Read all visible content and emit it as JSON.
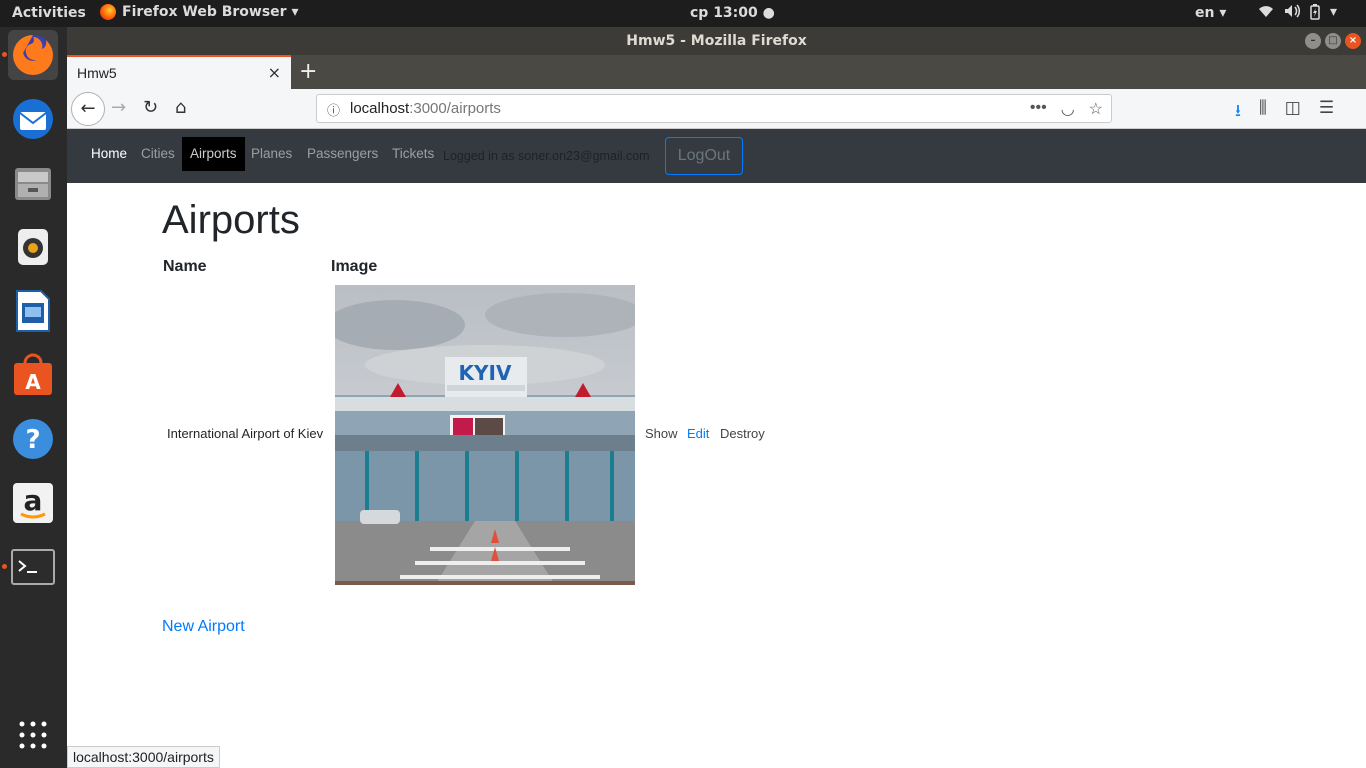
{
  "topbar": {
    "activities": "Activities",
    "app_menu": "Firefox Web Browser ▾",
    "clock": "cp 13:00 ●",
    "lang": "en ▾",
    "tray": [
      "wifi-icon",
      "volume-icon",
      "battery-icon",
      "menu-caret-icon"
    ]
  },
  "dock": {
    "items": [
      "firefox-icon",
      "thunderbird-icon",
      "files-icon",
      "rhythmbox-icon",
      "libreoffice-writer-icon",
      "software-center-icon",
      "help-icon",
      "amazon-icon",
      "terminal-icon",
      "show-apps-icon"
    ]
  },
  "window": {
    "title": "Hmw5 - Mozilla Firefox",
    "tab_title": "Hmw5",
    "tab_close": "×",
    "new_tab": "+",
    "url_host": "localhost",
    "url_path": ":3000/airports",
    "status_url": "localhost:3000/airports"
  },
  "site": {
    "nav": {
      "home": "Home",
      "cities": "Cities",
      "airports": "Airports",
      "planes": "Planes",
      "passengers": "Passengers",
      "tickets": "Tickets"
    },
    "logged_in": "Logged in as soner.on23@gmail.com",
    "logout": "LogOut"
  },
  "page": {
    "title": "Airports",
    "columns": [
      "Name",
      "Image"
    ],
    "rows": [
      {
        "name": "International Airport of Kiev",
        "image_sign": "KYIV",
        "actions": [
          "Show",
          "Edit",
          "Destroy"
        ]
      }
    ],
    "new_link": "New Airport"
  },
  "colors": {
    "navbar_bg": "#343a40",
    "link": "#007bff",
    "ubuntu_accent": "#e95420"
  }
}
